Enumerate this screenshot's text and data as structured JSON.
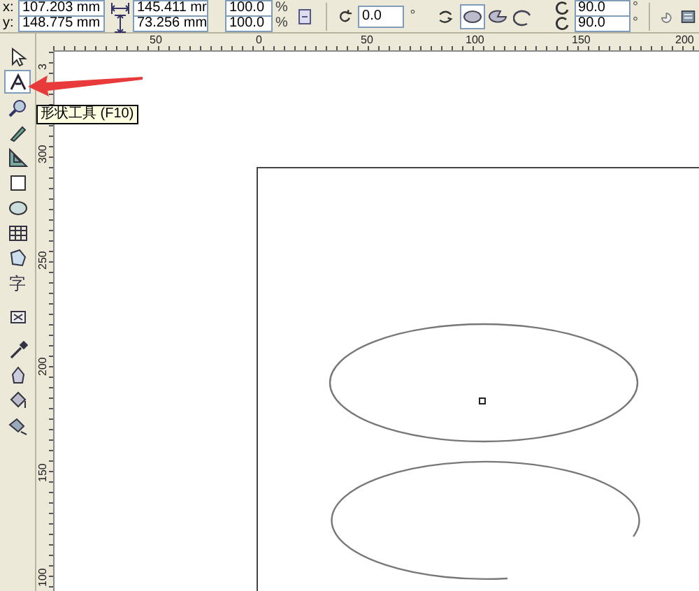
{
  "property_bar": {
    "position": [
      {
        "label": "x:",
        "value": "107.203 mm"
      },
      {
        "label": "y:",
        "value": "148.775 mm"
      }
    ],
    "size": [
      {
        "value": "145.411 mr"
      },
      {
        "value": "73.256 mm"
      }
    ],
    "scale": [
      {
        "value": "100.0",
        "unit": "%"
      },
      {
        "value": "100.0",
        "unit": "%"
      }
    ],
    "rotation": {
      "value": "0.0",
      "unit": "°"
    },
    "shape_buttons": [
      {
        "kind": "ellipse",
        "selected": true
      },
      {
        "kind": "pie",
        "selected": false
      },
      {
        "kind": "arc",
        "selected": false
      }
    ],
    "angles": [
      {
        "value": "90.0",
        "unit": "°"
      },
      {
        "value": "90.0",
        "unit": "°"
      }
    ]
  },
  "toolbox": [
    {
      "kind": "pick",
      "selected": false
    },
    {
      "kind": "shape",
      "selected": true
    },
    {
      "kind": "zoom",
      "selected": false
    },
    {
      "kind": "freehand",
      "selected": false
    },
    {
      "kind": "dimension",
      "selected": false
    },
    {
      "kind": "rectangle",
      "selected": false
    },
    {
      "kind": "ellipse",
      "selected": false
    },
    {
      "kind": "table",
      "selected": false
    },
    {
      "kind": "polygon",
      "selected": false
    },
    {
      "kind": "text",
      "glyph": "字",
      "selected": false
    },
    {
      "kind": "interactive",
      "selected": false
    },
    {
      "kind": "eyedropper",
      "selected": false
    },
    {
      "kind": "outline",
      "selected": false
    },
    {
      "kind": "fill",
      "selected": false
    },
    {
      "kind": "interactive_fill",
      "selected": false
    }
  ],
  "tooltip": "形状工具 (F10)",
  "horizontal_ruler": [
    "50",
    "0",
    "50",
    "100",
    "150",
    "200"
  ],
  "vertical_ruler": [
    "3",
    "300",
    "250",
    "200",
    "150",
    "100"
  ]
}
